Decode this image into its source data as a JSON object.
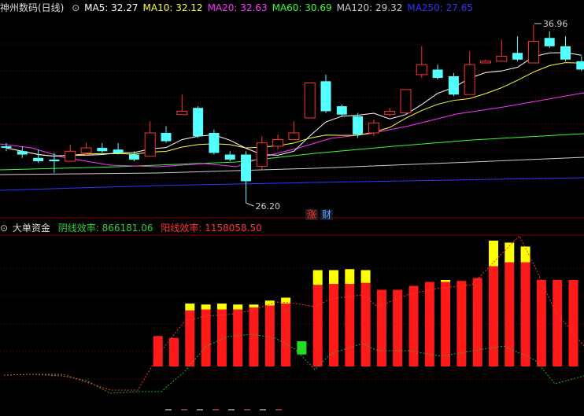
{
  "top_header": {
    "stock_name": "神州数码(日线)",
    "ma_items": [
      {
        "label": "MA5: 32.27",
        "color": "#ffffff"
      },
      {
        "label": "MA10: 32.12",
        "color": "#ffff33"
      },
      {
        "label": "MA20: 32.63",
        "color": "#ff33ff"
      },
      {
        "label": "MA60: 30.69",
        "color": "#33ff33"
      },
      {
        "label": "MA120: 29.32",
        "color": "#cccccc"
      },
      {
        "label": "MA250: 27.65",
        "color": "#3333ff"
      }
    ]
  },
  "annotations": {
    "high_label": "36.96",
    "low_label": "26.20"
  },
  "buttons": {
    "zhang": "涨",
    "cai": "财"
  },
  "bottom_header": {
    "indicator_name": "大单资金",
    "yin_label": "阴线效率: 866181.06",
    "yang_label": "阳线效率: 1158058.50"
  },
  "colors": {
    "up": "#ff3333",
    "down": "#54ffff",
    "grid": "#800000",
    "yellow": "#ffff00",
    "green_bar": "#22dd22"
  },
  "candles": [
    {
      "o": 29.6,
      "c": 29.5,
      "h": 29.8,
      "l": 29.3
    },
    {
      "o": 29.3,
      "c": 29.1,
      "h": 29.6,
      "l": 28.9
    },
    {
      "o": 28.9,
      "c": 28.7,
      "h": 29.4,
      "l": 28.6
    },
    {
      "o": 28.8,
      "c": 28.7,
      "h": 29.2,
      "l": 28.0
    },
    {
      "o": 28.7,
      "c": 29.3,
      "h": 29.7,
      "l": 28.7
    },
    {
      "o": 29.2,
      "c": 29.5,
      "h": 29.8,
      "l": 29.0
    },
    {
      "o": 29.5,
      "c": 29.3,
      "h": 29.8,
      "l": 29.2
    },
    {
      "o": 29.4,
      "c": 29.2,
      "h": 29.8,
      "l": 29.1
    },
    {
      "o": 29.1,
      "c": 28.8,
      "h": 29.3,
      "l": 28.7
    },
    {
      "o": 29.0,
      "c": 30.4,
      "h": 31.1,
      "l": 29.0
    },
    {
      "o": 30.4,
      "c": 29.9,
      "h": 30.8,
      "l": 29.8
    },
    {
      "o": 31.5,
      "c": 31.7,
      "h": 32.7,
      "l": 31.5
    },
    {
      "o": 31.9,
      "c": 30.2,
      "h": 32.0,
      "l": 30.1
    },
    {
      "o": 30.4,
      "c": 29.2,
      "h": 30.6,
      "l": 29.1
    },
    {
      "o": 29.1,
      "c": 28.8,
      "h": 29.3,
      "l": 28.7
    },
    {
      "o": 29.1,
      "c": 27.5,
      "h": 29.3,
      "l": 26.2
    },
    {
      "o": 28.4,
      "c": 29.8,
      "h": 30.2,
      "l": 28.2
    },
    {
      "o": 29.6,
      "c": 30.0,
      "h": 30.3,
      "l": 29.4
    },
    {
      "o": 30.0,
      "c": 30.4,
      "h": 31.1,
      "l": 30.0
    },
    {
      "o": 31.3,
      "c": 33.4,
      "h": 33.4,
      "l": 31.3
    },
    {
      "o": 33.5,
      "c": 31.7,
      "h": 33.9,
      "l": 31.6
    },
    {
      "o": 32.0,
      "c": 31.5,
      "h": 32.1,
      "l": 31.4
    },
    {
      "o": 31.4,
      "c": 30.3,
      "h": 31.6,
      "l": 30.1
    },
    {
      "o": 30.4,
      "c": 31.0,
      "h": 31.2,
      "l": 30.2
    },
    {
      "o": 31.5,
      "c": 31.7,
      "h": 31.9,
      "l": 31.4
    },
    {
      "o": 31.6,
      "c": 33.0,
      "h": 33.0,
      "l": 31.5
    },
    {
      "o": 33.9,
      "c": 34.5,
      "h": 35.6,
      "l": 33.7
    },
    {
      "o": 34.2,
      "c": 33.7,
      "h": 34.5,
      "l": 33.6
    },
    {
      "o": 33.8,
      "c": 32.7,
      "h": 34.0,
      "l": 32.6
    },
    {
      "o": 32.7,
      "c": 34.5,
      "h": 35.3,
      "l": 32.7
    },
    {
      "o": 34.6,
      "c": 34.7,
      "h": 34.8,
      "l": 34.6
    },
    {
      "o": 34.7,
      "c": 35.0,
      "h": 36.0,
      "l": 34.7
    },
    {
      "o": 35.2,
      "c": 34.8,
      "h": 36.2,
      "l": 34.7
    },
    {
      "o": 34.6,
      "c": 35.9,
      "h": 36.9,
      "l": 34.6
    },
    {
      "o": 36.1,
      "c": 35.6,
      "h": 36.5,
      "l": 35.5
    },
    {
      "o": 35.6,
      "c": 34.8,
      "h": 36.2,
      "l": 34.7
    },
    {
      "o": 34.7,
      "c": 34.2,
      "h": 35.0,
      "l": 34.1
    }
  ],
  "money_bars": [
    {
      "red": 0,
      "yellow": 0,
      "green": 0
    },
    {
      "red": 0,
      "yellow": 0,
      "green": 0
    },
    {
      "red": 0,
      "yellow": 0,
      "green": 0
    },
    {
      "red": 0,
      "yellow": 0,
      "green": 0
    },
    {
      "red": 0,
      "yellow": 0,
      "green": 0
    },
    {
      "red": 0,
      "yellow": 0,
      "green": 0
    },
    {
      "red": 0,
      "yellow": 0,
      "green": 0
    },
    {
      "red": 0,
      "yellow": 0,
      "green": 0
    },
    {
      "red": 0,
      "yellow": 0,
      "green": 0
    },
    {
      "red": 0.31,
      "yellow": 0,
      "green": 0
    },
    {
      "red": 0.29,
      "yellow": 0,
      "green": 0
    },
    {
      "red": 0.57,
      "yellow": 0.07,
      "green": 0
    },
    {
      "red": 0.58,
      "yellow": 0.05,
      "green": 0
    },
    {
      "red": 0.58,
      "yellow": 0.06,
      "green": 0
    },
    {
      "red": 0.58,
      "yellow": 0.05,
      "green": 0
    },
    {
      "red": 0.6,
      "yellow": 0.03,
      "green": 0
    },
    {
      "red": 0.62,
      "yellow": 0.05,
      "green": 0
    },
    {
      "red": 0.64,
      "yellow": 0.06,
      "green": 0
    },
    {
      "red": 0,
      "yellow": 0,
      "green": 0.07
    },
    {
      "red": 0.83,
      "yellow": 0.15,
      "green": 0
    },
    {
      "red": 0.84,
      "yellow": 0.14,
      "green": 0
    },
    {
      "red": 0.84,
      "yellow": 0.15,
      "green": 0
    },
    {
      "red": 0.85,
      "yellow": 0.13,
      "green": 0
    },
    {
      "red": 0.78,
      "yellow": 0,
      "green": 0
    },
    {
      "red": 0.78,
      "yellow": 0,
      "green": 0
    },
    {
      "red": 0.82,
      "yellow": 0,
      "green": 0
    },
    {
      "red": 0.86,
      "yellow": 0,
      "green": 0
    },
    {
      "red": 0.86,
      "yellow": 0.02,
      "green": 0
    },
    {
      "red": 0.87,
      "yellow": 0,
      "green": 0
    },
    {
      "red": 0.9,
      "yellow": 0,
      "green": 0
    },
    {
      "red": 1.02,
      "yellow": 0.26,
      "green": 0
    },
    {
      "red": 1.06,
      "yellow": 0.2,
      "green": 0
    },
    {
      "red": 1.06,
      "yellow": 0.16,
      "green": 0
    },
    {
      "red": 0.88,
      "yellow": 0,
      "green": 0
    },
    {
      "red": 0.88,
      "yellow": 0,
      "green": 0
    },
    {
      "red": 0.88,
      "yellow": 0,
      "green": 0
    },
    {
      "red": 0,
      "yellow": 0,
      "green": 0
    }
  ]
}
